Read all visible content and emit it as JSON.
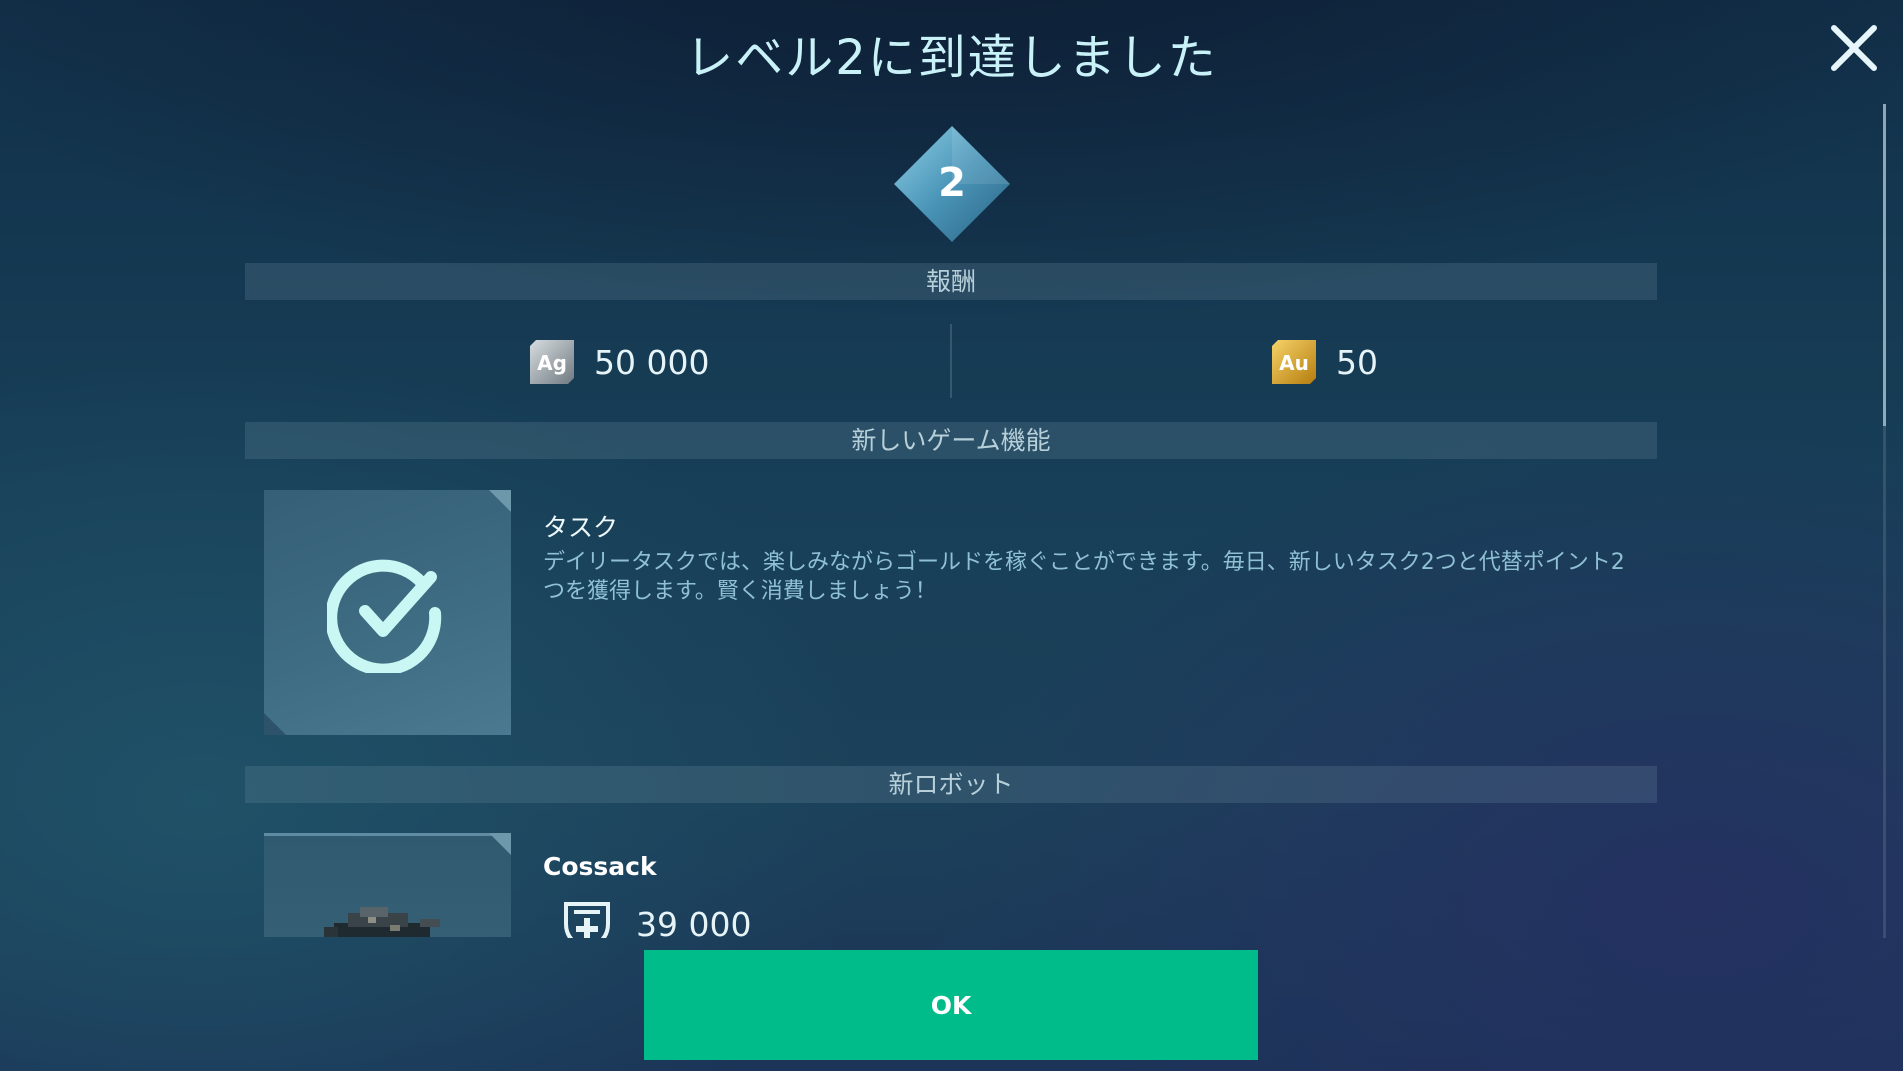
{
  "dialog": {
    "title": "レベル2に到達しました",
    "level": "2"
  },
  "rewards": {
    "header": "報酬",
    "items": [
      {
        "icon": "silver-currency-icon",
        "icon_label": "Ag",
        "value": "50 000",
        "color": "#9aa3a8"
      },
      {
        "icon": "gold-currency-icon",
        "icon_label": "Au",
        "value": "50",
        "color": "#d9a21f"
      }
    ]
  },
  "new_features": {
    "header": "新しいゲーム機能",
    "feature": {
      "icon": "checkmark-circle-icon",
      "name": "タスク",
      "description": "デイリータスクでは、楽しみながらゴールドを稼ぐことができます。毎日、新しいタスク2つと代替ポイント2つを獲得します。賢く消費しましょう！"
    }
  },
  "new_robot": {
    "header": "新ロボット",
    "robot": {
      "name": "Cossack",
      "health_icon": "health-shield-icon",
      "health": "39 000"
    }
  },
  "buttons": {
    "ok_label": "OK",
    "close_icon": "close-icon"
  },
  "colors": {
    "accent_button": "#00bb8a",
    "title_text": "#c9f2f8",
    "badge": "#5aa4c4"
  }
}
